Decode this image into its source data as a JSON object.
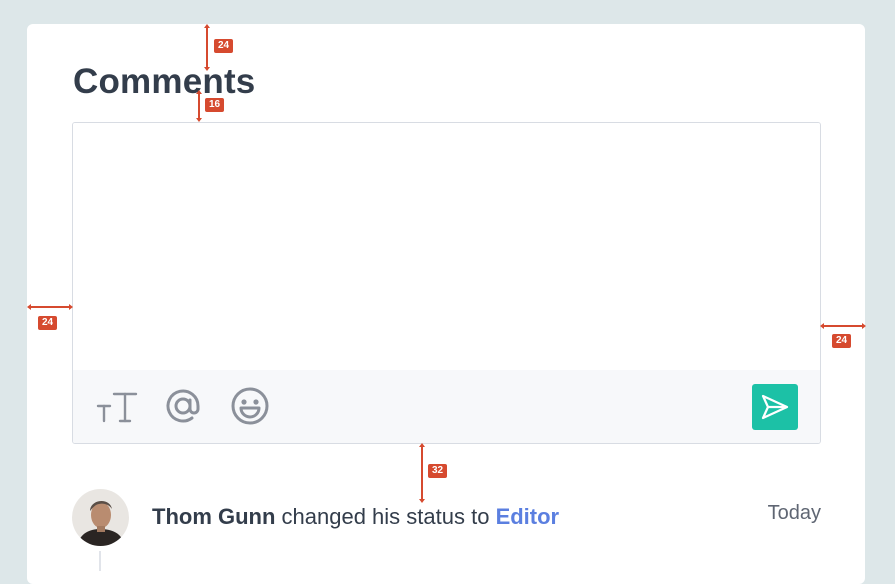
{
  "comments": {
    "title": "Comments",
    "input_value": "",
    "toolbar": {
      "icons": [
        "text-format-icon",
        "mention-icon",
        "emoji-icon",
        "send-icon"
      ]
    },
    "send_button_color": "#1cc1a6"
  },
  "activity": {
    "user_name": "Thom Gunn",
    "action_text": " changed his status to ",
    "status_value": "Editor",
    "timestamp": "Today",
    "status_color": "#5b7fe0"
  },
  "annotations": {
    "top_spacing": "24",
    "title_spacing": "16",
    "left_spacing": "24",
    "right_spacing": "24",
    "bottom_spacing": "32",
    "color": "#d64a2f"
  }
}
